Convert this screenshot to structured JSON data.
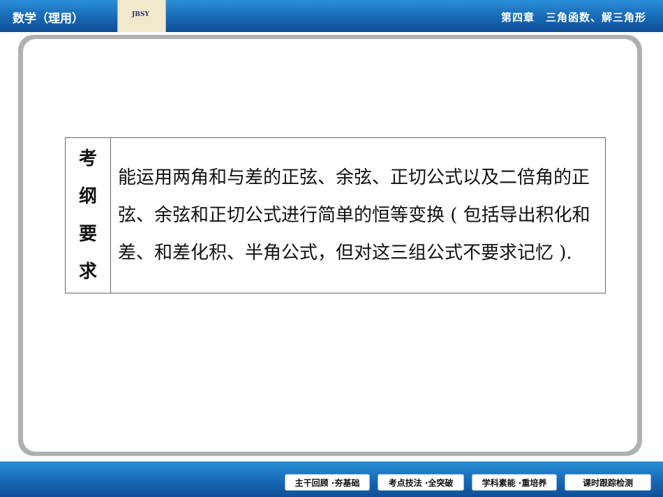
{
  "header": {
    "left_title": "数学（理用）",
    "logo_text": "JBSY",
    "right_title": "第四章　三角函数、解三角形"
  },
  "table": {
    "label_chars": [
      "考",
      "纲",
      "要",
      "求"
    ],
    "content": "能运用两角和与差的正弦、余弦、正切公式以及二倍角的正弦、余弦和正切公式进行简单的恒等变换 ( 包括导出积化和差、和差化积、半角公式，但对这三组公式不要求记忆 )."
  },
  "footer": {
    "buttons": [
      {
        "label": "主干回顾 ·夯基础"
      },
      {
        "label": "考点技法 ·全突破"
      },
      {
        "label": "学科素能 ·重培养"
      },
      {
        "label": "课时跟踪检测"
      }
    ]
  }
}
